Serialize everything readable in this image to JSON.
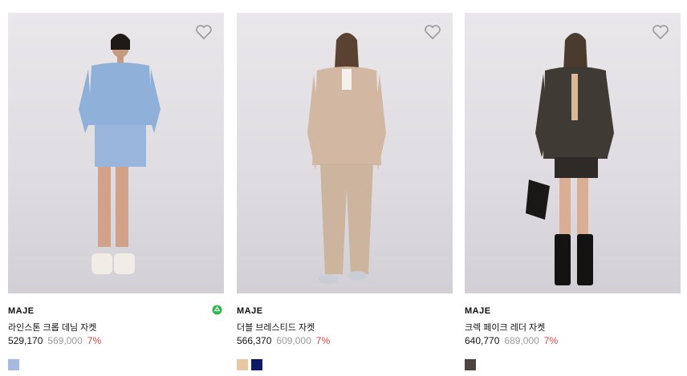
{
  "products": [
    {
      "brand": "MAJE",
      "name": "라인스톤 크롭 데님 자켓",
      "price": "529,170",
      "original_price": "569,000",
      "discount": "7%",
      "eco_badge": true,
      "swatches": [
        "#a7b9dc"
      ]
    },
    {
      "brand": "MAJE",
      "name": "더블 브레스티드 자켓",
      "price": "566,370",
      "original_price": "609,000",
      "discount": "7%",
      "eco_badge": false,
      "swatches": [
        "#e6c8a2",
        "#0f1a66"
      ]
    },
    {
      "brand": "MAJE",
      "name": "크렉 페이크 레더 자켓",
      "price": "640,770",
      "original_price": "689,000",
      "discount": "7%",
      "eco_badge": false,
      "swatches": [
        "#4d4540"
      ]
    }
  ],
  "icons": {
    "wishlist": "heart-outline-icon",
    "eco": "recycle-icon"
  },
  "colors": {
    "discount": "#d64545",
    "original_price": "#9a9a9a",
    "eco": "#2db84b"
  }
}
